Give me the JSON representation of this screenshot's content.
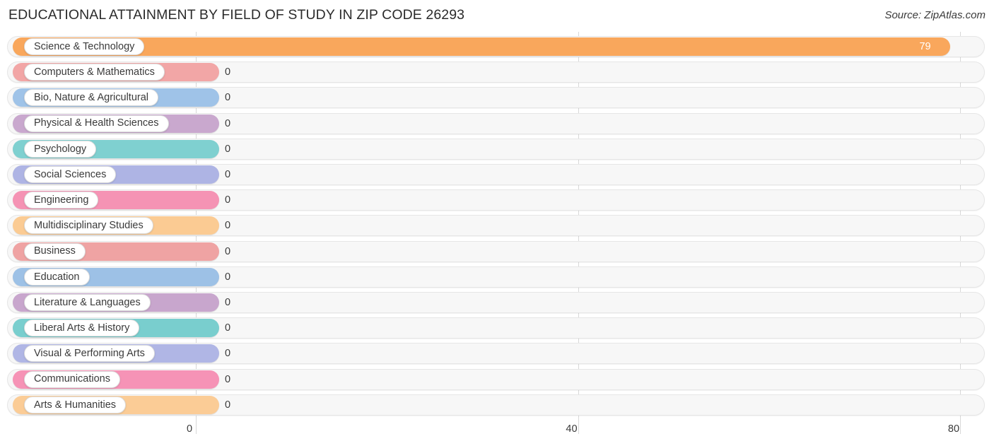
{
  "header": {
    "title": "EDUCATIONAL ATTAINMENT BY FIELD OF STUDY IN ZIP CODE 26293",
    "source": "Source: ZipAtlas.com"
  },
  "chart_data": {
    "type": "bar",
    "orientation": "horizontal",
    "title": "EDUCATIONAL ATTAINMENT BY FIELD OF STUDY IN ZIP CODE 26293",
    "xlabel": "",
    "ylabel": "",
    "xlim": [
      0,
      80
    ],
    "xticks": [
      0,
      40,
      80
    ],
    "xtick_labels": [
      "0",
      "40",
      "80"
    ],
    "grid": true,
    "legend": "none",
    "categories": [
      "Science & Technology",
      "Computers & Mathematics",
      "Bio, Nature & Agricultural",
      "Physical & Health Sciences",
      "Psychology",
      "Social Sciences",
      "Engineering",
      "Multidisciplinary Studies",
      "Business",
      "Education",
      "Literature & Languages",
      "Liberal Arts & History",
      "Visual & Performing Arts",
      "Communications",
      "Arts & Humanities"
    ],
    "values": [
      79,
      0,
      0,
      0,
      0,
      0,
      0,
      0,
      0,
      0,
      0,
      0,
      0,
      0,
      0
    ],
    "value_labels": [
      "79",
      "0",
      "0",
      "0",
      "0",
      "0",
      "0",
      "0",
      "0",
      "0",
      "0",
      "0",
      "0",
      "0",
      "0"
    ],
    "colors": [
      "#F9A75C",
      "#F2A6A6",
      "#9FC3E8",
      "#C9A8CE",
      "#7FD0D0",
      "#AEB4E4",
      "#F593B4",
      "#FBCB93",
      "#EFA3A3",
      "#9DC1E6",
      "#C8A6CD",
      "#79CECE",
      "#B0B6E5",
      "#F693B6",
      "#FBCC96"
    ]
  }
}
